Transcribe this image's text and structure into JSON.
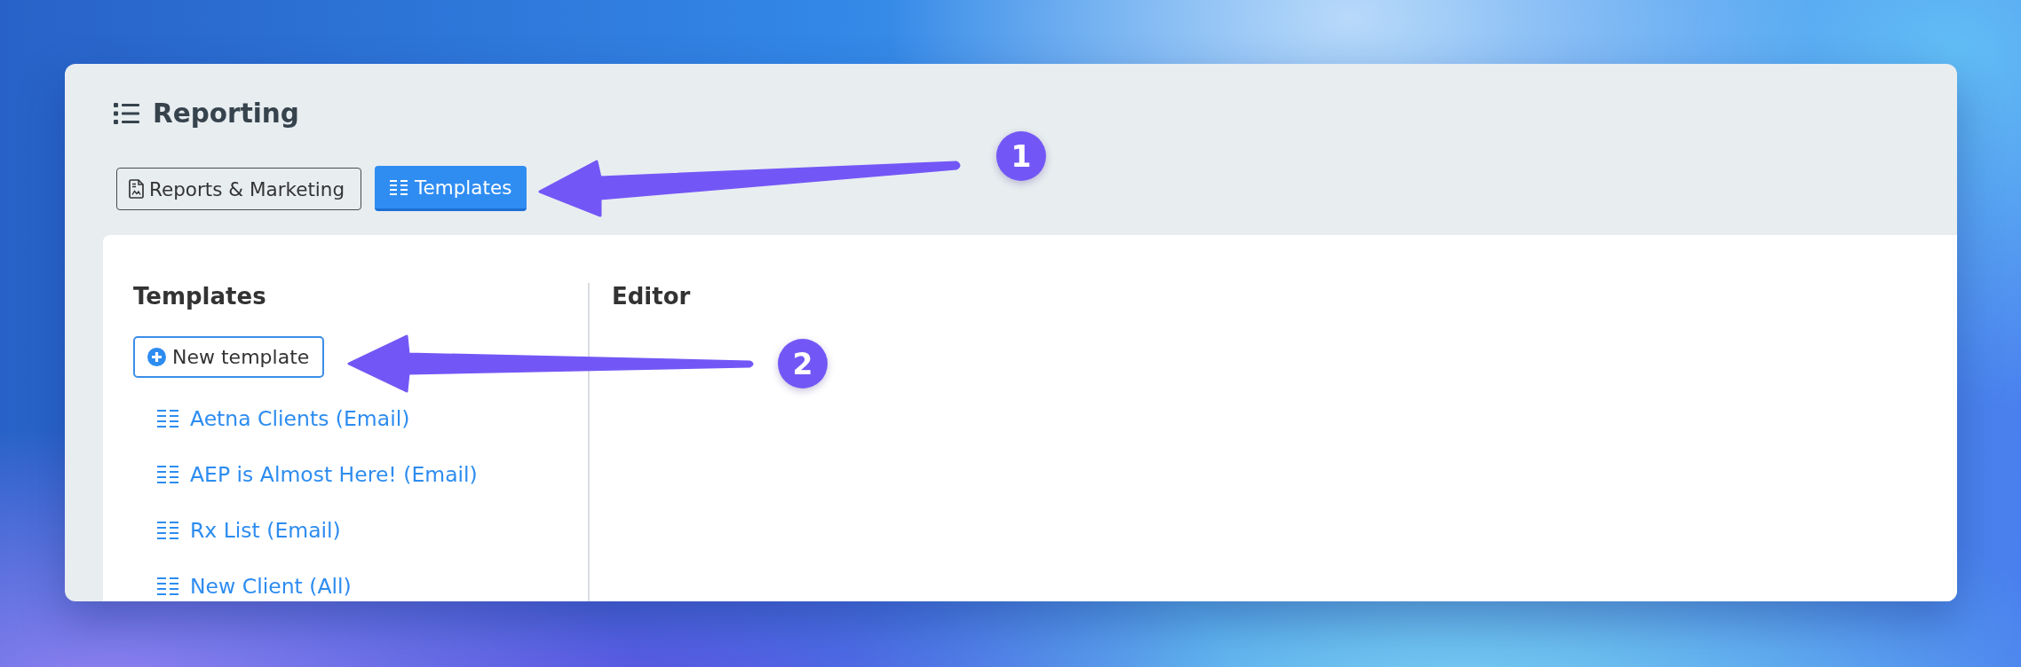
{
  "header": {
    "title": "Reporting",
    "tabs": [
      {
        "label": "Reports & Marketing",
        "kind": "document",
        "selected": false
      },
      {
        "label": "Templates",
        "kind": "list",
        "selected": true
      }
    ]
  },
  "templates_panel": {
    "heading": "Templates",
    "new_button": "New template",
    "items": [
      {
        "label": "Aetna Clients (Email)"
      },
      {
        "label": "AEP is Almost Here! (Email)"
      },
      {
        "label": "Rx List (Email)"
      },
      {
        "label": "New Client (All)"
      }
    ]
  },
  "editor_panel": {
    "heading": "Editor"
  },
  "annotations": [
    {
      "number": "1"
    },
    {
      "number": "2"
    }
  ]
}
